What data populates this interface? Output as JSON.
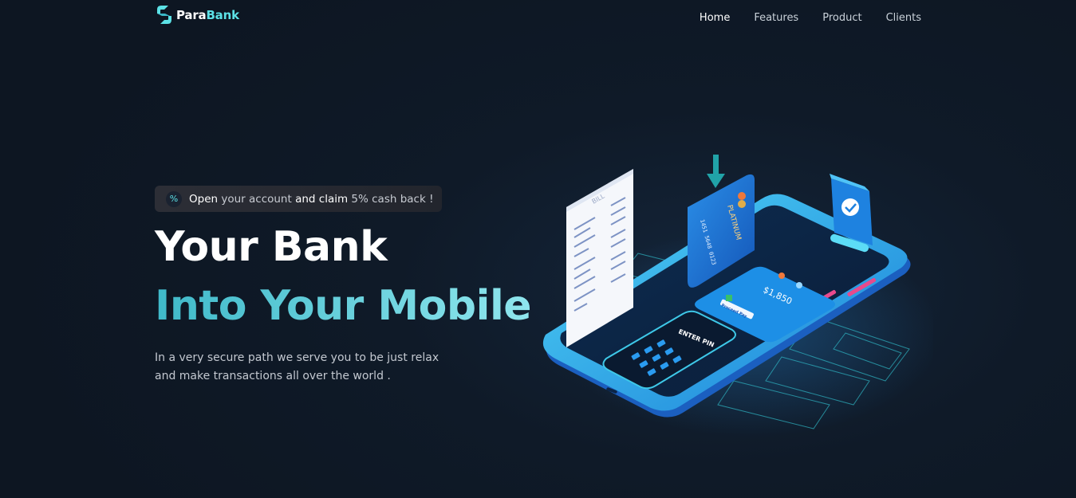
{
  "brand": {
    "name_part1": "Para",
    "name_part2": "Bank"
  },
  "nav": {
    "items": [
      {
        "label": "Home",
        "active": true
      },
      {
        "label": "Features",
        "active": false
      },
      {
        "label": "Product",
        "active": false
      },
      {
        "label": "Clients",
        "active": false
      }
    ]
  },
  "promo": {
    "icon": "percent-icon",
    "part1": "Open",
    "part2": " your account ",
    "part3": "and claim",
    "part4": " 5% cash back !"
  },
  "hero": {
    "title_line1": "Your Bank",
    "title_line2": "Into Your Mobile",
    "description": "In a very secure path we serve you to be just relax and make transactions all over the world ."
  },
  "illustration": {
    "bill_label": "BILL",
    "card_label": "PLATINUM",
    "card_number": "1451 5648 0123",
    "amount": "$1,850",
    "pin_label": "ENTER PIN",
    "proceed_label": "Proceed Pay"
  },
  "colors": {
    "accent": "#5ce1e6",
    "background": "#0f1a28"
  }
}
